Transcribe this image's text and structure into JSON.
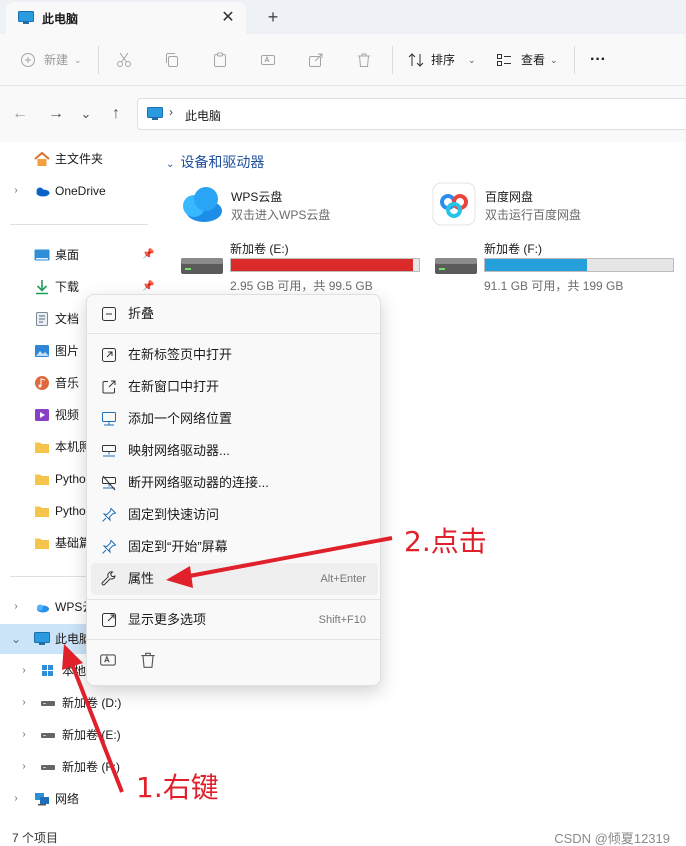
{
  "window": {
    "tab_title": "此电脑",
    "close_glyph": "✕",
    "newtab_glyph": "+"
  },
  "toolbar": {
    "new_label": "新建",
    "sort_label": "排序",
    "view_label": "查看",
    "more_glyph": "···",
    "icons": [
      "cut-icon",
      "copy-icon",
      "paste-icon",
      "rename-icon",
      "share-icon",
      "delete-icon"
    ]
  },
  "address": {
    "back_glyph": "←",
    "forward_glyph": "→",
    "recent_glyph": "⌄",
    "up_glyph": "↑",
    "chevron": "›",
    "path": "此电脑"
  },
  "sidebar": {
    "items": [
      {
        "label": "主文件夹"
      },
      {
        "label": "OneDrive"
      },
      {
        "label": "桌面"
      },
      {
        "label": "下载"
      },
      {
        "label": "文档"
      },
      {
        "label": "图片"
      },
      {
        "label": "音乐"
      },
      {
        "label": "视频"
      },
      {
        "label": "本机照"
      },
      {
        "label": "Pytho"
      },
      {
        "label": "Pytho"
      },
      {
        "label": "基础篇"
      },
      {
        "label": "WPS云"
      },
      {
        "label": "此电脑"
      },
      {
        "label": "本地"
      },
      {
        "label": "新加卷 (D:)"
      },
      {
        "label": "新加卷 (E:)"
      },
      {
        "label": "新加卷 (F:)"
      },
      {
        "label": "网络"
      }
    ]
  },
  "content": {
    "group_title": "设备和驱动器",
    "tiles": [
      {
        "name": "WPS云盘",
        "sub": "双击进入WPS云盘"
      },
      {
        "name": "百度网盘",
        "sub": "双击运行百度网盘"
      },
      {
        "name": "新加卷 (E:)",
        "sub": "2.95 GB 可用，共 99.5 GB",
        "used_fraction": 0.97,
        "bar_color": "#da2a2a"
      },
      {
        "name": "新加卷 (F:)",
        "sub": "91.1 GB 可用，共 199 GB",
        "used_fraction": 0.54,
        "bar_color": "#26a0da"
      }
    ]
  },
  "context_menu": {
    "items": [
      {
        "label": "折叠",
        "icon": "collapse-icon",
        "shortcut": ""
      },
      {
        "label": "在新标签页中打开",
        "icon": "open-new-tab-icon",
        "shortcut": ""
      },
      {
        "label": "在新窗口中打开",
        "icon": "open-new-window-icon",
        "shortcut": ""
      },
      {
        "label": "添加一个网络位置",
        "icon": "network-location-icon",
        "shortcut": ""
      },
      {
        "label": "映射网络驱动器...",
        "icon": "map-drive-icon",
        "shortcut": ""
      },
      {
        "label": "断开网络驱动器的连接...",
        "icon": "disconnect-drive-icon",
        "shortcut": ""
      },
      {
        "label": "固定到快速访问",
        "icon": "pin-icon",
        "shortcut": ""
      },
      {
        "label": "固定到“开始”屏幕",
        "icon": "pin-start-icon",
        "shortcut": ""
      },
      {
        "label": "属性",
        "icon": "wrench-icon",
        "shortcut": "Alt+Enter"
      },
      {
        "label": "显示更多选项",
        "icon": "more-options-icon",
        "shortcut": "Shift+F10"
      }
    ]
  },
  "annotations": {
    "click_label": "2.点击",
    "right_click_label": "1.右键",
    "color": "#e0202a"
  },
  "status": {
    "item_count": "7 个项目",
    "watermark": "CSDN @倾夏12319"
  }
}
